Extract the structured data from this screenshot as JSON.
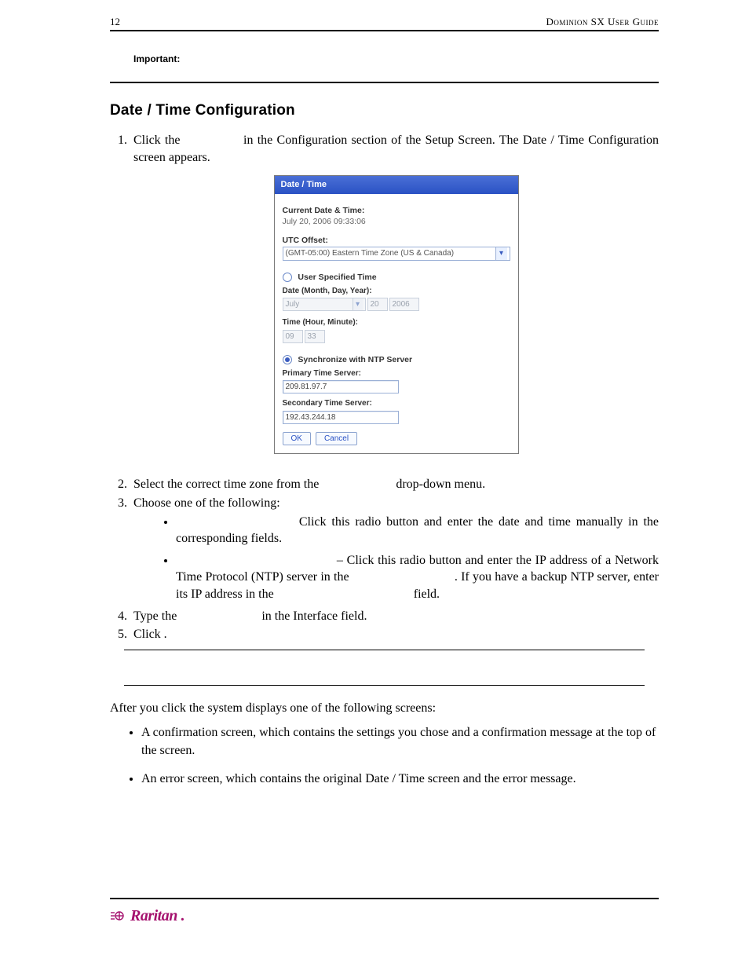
{
  "header": {
    "page_num": "12",
    "doc_title": "Dominion SX User Guide"
  },
  "important": {
    "label": "Important:"
  },
  "section": {
    "heading": "Date / Time Configuration"
  },
  "steps": {
    "s1a": "Click  the  ",
    "s1b": "  in  the  Configuration  section  of  the  Setup  Screen.  The  Date  /  Time Configuration screen appears.",
    "s2a": "Select the correct time zone from the ",
    "s2b": " drop-down menu.",
    "s3": "Choose one of the following:",
    "b1": " Click this radio button and enter the date and time manually in the corresponding fields.",
    "b2a": " – Click this radio button and enter the IP address of a Network Time Protocol (NTP) server in the ",
    "b2b": ". If you have a backup NTP server, enter its IP address in the ",
    "b2c": " field.",
    "s4a": "Type the ",
    "s4b": " in the Interface field.",
    "s5": "Click      ."
  },
  "after": {
    "line": "After you click         the system displays one of the following screens:",
    "bul1": "A confirmation screen, which contains the settings you chose and a confirmation message at the top of the screen.",
    "bul2": "An error screen, which contains the original Date / Time screen and the error message."
  },
  "figure": {
    "title": "Date / Time",
    "curr_label": "Current Date & Time:",
    "curr_val": "July 20, 2006 09:33:06",
    "utc_label": "UTC Offset:",
    "utc_val": "(GMT-05:00) Eastern Time Zone (US & Canada)",
    "user_spec": "User Specified Time",
    "date_label": "Date (Month, Day, Year):",
    "month": "July",
    "day": "20",
    "year": "2006",
    "time_label": "Time (Hour, Minute):",
    "hour": "09",
    "minute": "33",
    "sync": "Synchronize with NTP Server",
    "primary_label": "Primary Time Server:",
    "primary_val": "209.81.97.7",
    "secondary_label": "Secondary Time Server:",
    "secondary_val": "192.43.244.18",
    "ok": "OK",
    "cancel": "Cancel"
  },
  "footer": {
    "brand": "Raritan",
    "dot": "."
  }
}
